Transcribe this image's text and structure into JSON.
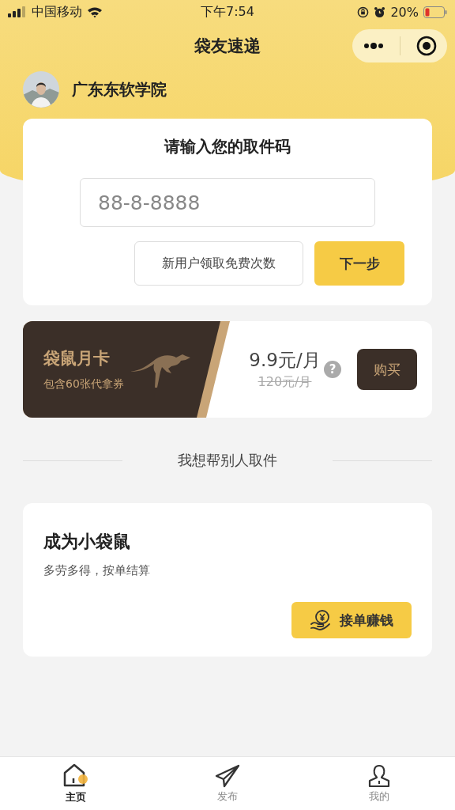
{
  "status_bar": {
    "carrier": "中国移动",
    "time": "下午7:54",
    "battery": "20%"
  },
  "nav": {
    "title": "袋友速递"
  },
  "user": {
    "name": "广东东软学院"
  },
  "pickup": {
    "title": "请输入您的取件码",
    "placeholder": "88-8-8888",
    "free_button": "新用户领取免费次数",
    "next_button": "下一步"
  },
  "membership": {
    "title": "袋鼠月卡",
    "subtitle": "包含60张代拿券",
    "price": "9.9元/月",
    "old_price": "120元/月",
    "help": "?",
    "buy_button": "购买"
  },
  "divider_text": "我想帮别人取件",
  "courier": {
    "title": "成为小袋鼠",
    "subtitle": "多劳多得，按单结算",
    "button": "接单赚钱"
  },
  "tabs": [
    {
      "label": "主页",
      "kind": "home",
      "selected": true
    },
    {
      "label": "发布",
      "kind": "send",
      "selected": false
    },
    {
      "label": "我的",
      "kind": "user",
      "selected": false
    }
  ]
}
